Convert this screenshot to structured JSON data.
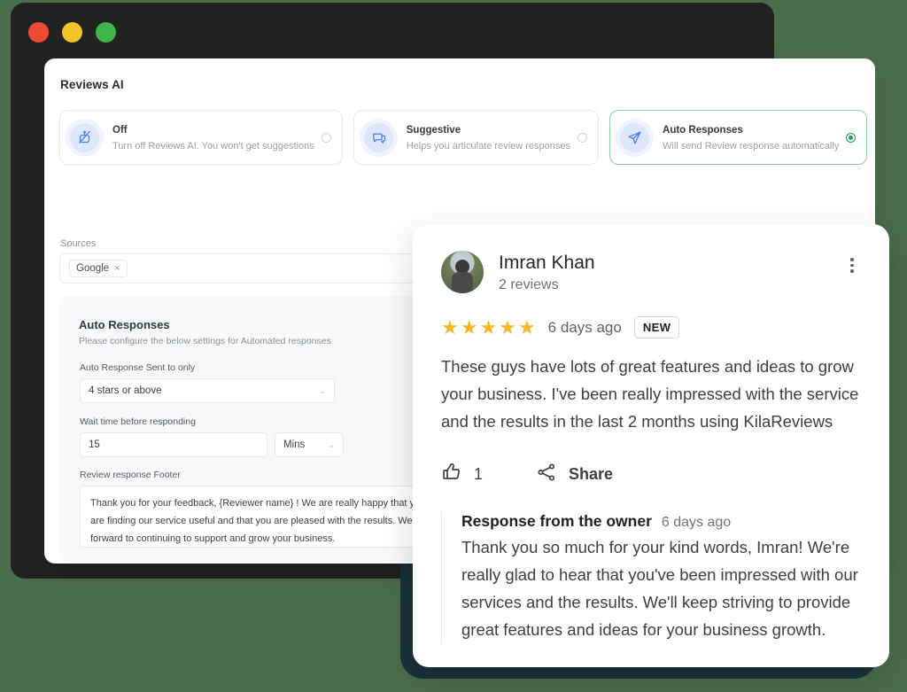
{
  "window": {
    "traffic_lights": [
      "close",
      "minimize",
      "maximize"
    ]
  },
  "panel": {
    "title": "Reviews AI",
    "modes": [
      {
        "name": "Off",
        "desc": "Turn off Reviews AI. You won't get suggestions",
        "icon": "robot-off-icon",
        "selected": false
      },
      {
        "name": "Suggestive",
        "desc": "Helps you articulate review responses",
        "icon": "chat-bubble-icon",
        "selected": false
      },
      {
        "name": "Auto Responses",
        "desc": "Will send Review response automatically",
        "icon": "paper-plane-icon",
        "selected": true
      }
    ],
    "sources": {
      "label": "Sources",
      "chips": [
        {
          "label": "Google",
          "remove": "×"
        }
      ],
      "caret": "⌄"
    },
    "settings": {
      "title": "Auto Responses",
      "subtitle": "Please configure the below settings for Automated responses",
      "star_filter": {
        "label": "Auto Response Sent to only",
        "value": "4 stars or above",
        "caret": "⌄"
      },
      "wait_time": {
        "label": "Wait time before responding",
        "value": "15",
        "unit": "Mins",
        "caret": "⌄"
      },
      "footer": {
        "label": "Review response Footer",
        "value": "Thank you for your feedback, {Reviewer name} ! We are really happy that you are finding our service useful and that you are pleased with the results. We look forward to continuing to support and grow your business."
      }
    }
  },
  "review": {
    "author": "Imran Khan",
    "review_count": "2 reviews",
    "avatar": "user-avatar",
    "menu_icon": "kebab-menu-icon",
    "rating": 5,
    "star_glyph": "★",
    "date": "6 days ago",
    "badge": "NEW",
    "text": "These guys have lots of great features and ideas to grow your business. I've been really impressed with the service and the results in the last 2 months using KilaReviews",
    "actions": {
      "like_icon": "thumbs-up-icon",
      "like_count": "1",
      "share_icon": "share-icon",
      "share_label": "Share"
    },
    "owner_response": {
      "title": "Response from the owner",
      "date": "6 days ago",
      "text": "Thank you so much for your kind words, Imran! We're really glad to hear that you've been impressed with our services and the results. We'll keep striving to provide great features and ideas for your business growth."
    }
  },
  "colors": {
    "background": "#4a6d4c",
    "chrome": "#222222",
    "navy_shadow": "#1b313b",
    "accent_green": "#1a9e52",
    "star_gold": "#f5b826",
    "icon_blue": "#4c7df0"
  }
}
